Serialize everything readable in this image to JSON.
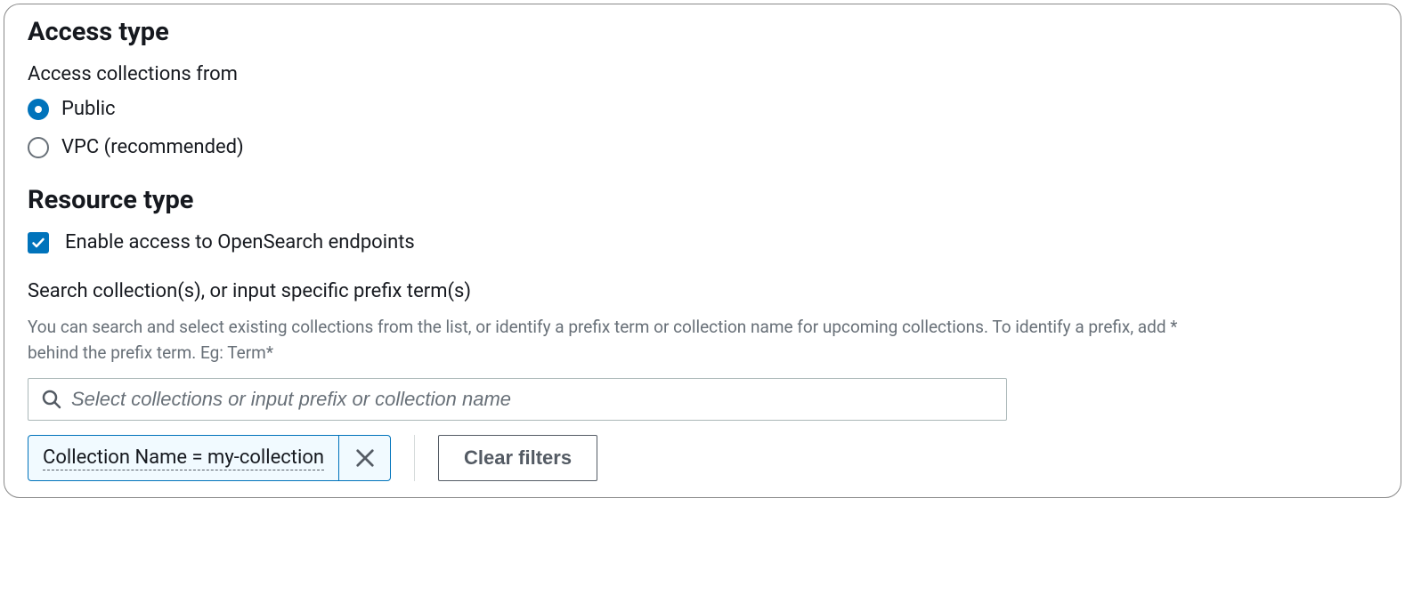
{
  "access_type": {
    "heading": "Access type",
    "field_label": "Access collections from",
    "options": {
      "public": "Public",
      "vpc": "VPC (recommended)"
    },
    "selected": "public"
  },
  "resource_type": {
    "heading": "Resource type",
    "checkbox_label": "Enable access to OpenSearch endpoints",
    "checkbox_checked": true,
    "search_label": "Search collection(s), or input specific prefix term(s)",
    "helper_text": "You can search and select existing collections from the list, or identify a prefix term or collection name for upcoming collections. To identify a prefix, add * behind the prefix term. Eg: Term*",
    "search_placeholder": "Select collections or input prefix or collection name",
    "filter_token": "Collection Name = my-collection",
    "clear_filters_label": "Clear filters"
  }
}
